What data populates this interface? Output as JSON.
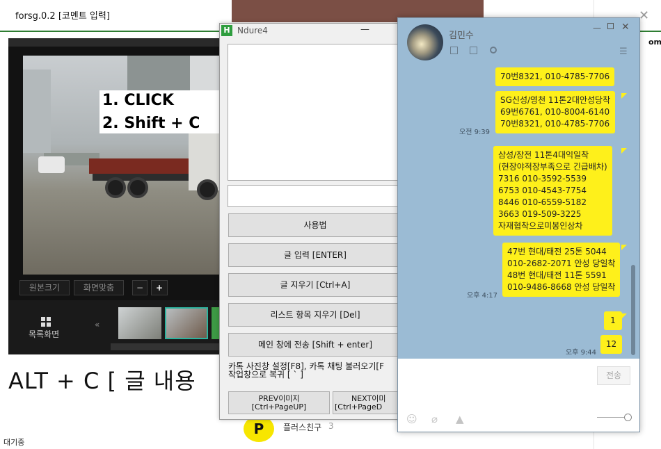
{
  "forsg": {
    "title": "forsg.0.2 [코멘트 입력]",
    "overlay_line1": "1. CLICK",
    "overlay_line2": "2. Shift + C",
    "btn_original": "원본크기",
    "btn_fit": "화면맞춤",
    "btn_minus": "−",
    "btn_plus": "+",
    "list_view": "목록화면",
    "prev_arrow": "«",
    "alt_text": "ALT + C [ 글 내용",
    "status": "대기중"
  },
  "ndure": {
    "title": "Ndure4",
    "min": "—",
    "btn_usage": "사용법",
    "btn_input": "글 입력 [ENTER]",
    "btn_clear": "글 지우기 [Ctrl+A]",
    "btn_list_delete": "리스트 항목 지우기 [Del]",
    "btn_send_main": "메인 창에 전송 [Shift + enter]",
    "info_line1": "카톡 사진창 설정[F8], 카톡 채팅 불러오기[F",
    "info_line2": "작업창으로 복귀 [ ` ]",
    "btn_prev_l1": "PREV이미지",
    "btn_prev_l2": "[Ctrl+PageUP]",
    "btn_next_l1": "NEXT이미",
    "btn_next_l2": "[Ctrl+PageD"
  },
  "middle": {
    "plus_logo": "P",
    "plus_label": "플러스친구",
    "plus_count": "3",
    "right_fragment": "om",
    "close": "✕"
  },
  "chat": {
    "name": "김민수",
    "min": "—",
    "close": "✕",
    "menu": "☰",
    "send": "전송",
    "messages": [
      {
        "text": "70번8321, 010-4785-7706",
        "time": ""
      },
      {
        "text": "SG신성/영천 11톤2대안성당착\n69번6761, 010-8004-6140\n70번8321, 010-4785-7706",
        "time": "오전 9:39"
      },
      {
        "text": "삼성/장전 11톤4대익일착\n(현장야적장부족으로 긴급배차)\n7316 010-3592-5539\n6753 010-4543-7754\n8446 010-6559-5182\n3663 019-509-3225\n자재협착으로미봉인상차",
        "time": ""
      },
      {
        "text": "47번 현대/태전 25톤 5044\n010-2682-2071 안성 당일착\n48번 현대/태전 11톤 5591\n010-9486-8668 안성 당일착",
        "time": "오후 4:17"
      },
      {
        "text": "1",
        "time": ""
      },
      {
        "text": "12",
        "time": "오후 9:44"
      }
    ]
  },
  "colors": {
    "bubble": "#fef01b",
    "chat_bg": "#9bbbd4",
    "accent_green": "#2e7d32",
    "mid_header": "#7b4f45"
  }
}
